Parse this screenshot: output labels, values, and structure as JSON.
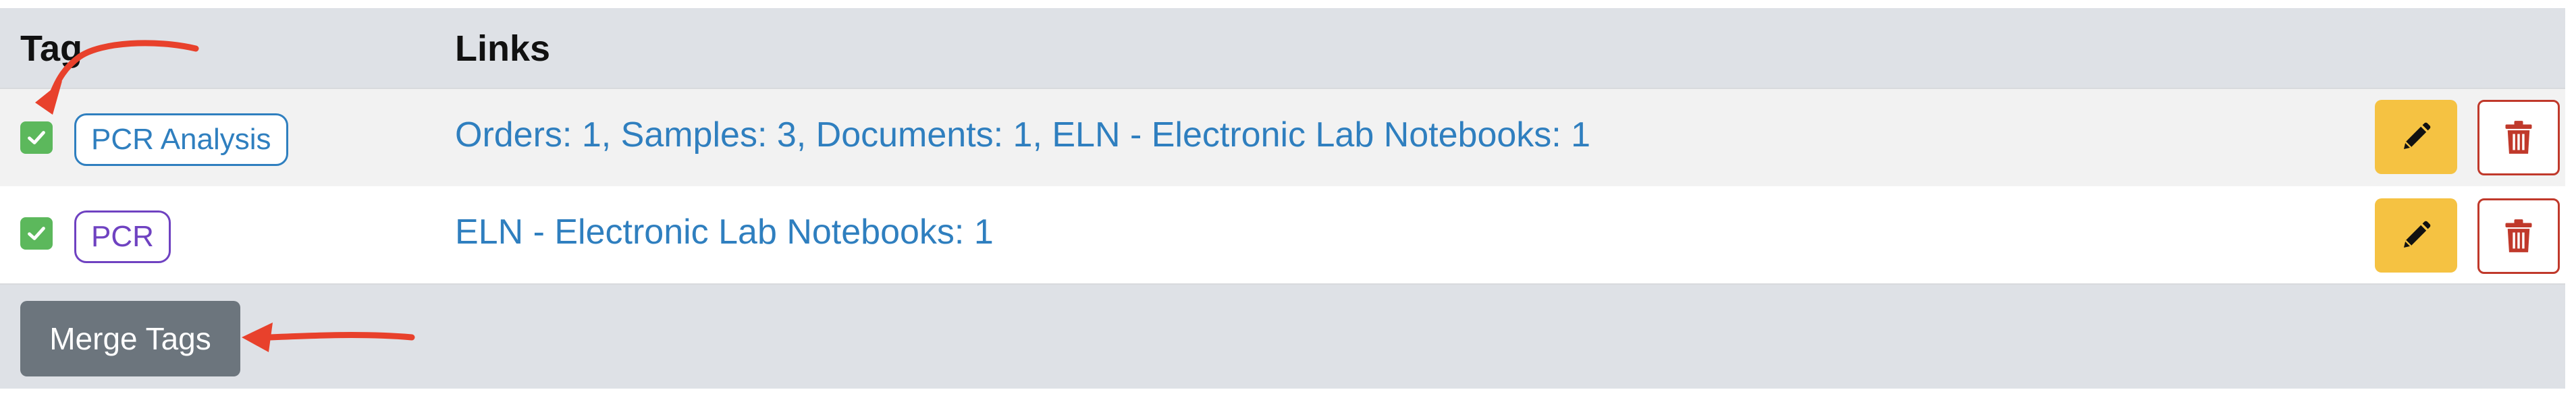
{
  "table": {
    "headers": {
      "tag": "Tag",
      "links": "Links"
    },
    "rows": [
      {
        "checked": true,
        "tag": "PCR Analysis",
        "tag_color": "#2f7fbf",
        "links": "Orders: 1, Samples: 3, Documents: 1, ELN - Electronic Lab Notebooks: 1"
      },
      {
        "checked": true,
        "tag": "PCR",
        "tag_color": "#6f42c1",
        "links": "ELN - Electronic Lab Notebooks: 1"
      }
    ],
    "row_actions": {
      "edit_icon": "pencil-icon",
      "delete_icon": "trash-icon"
    }
  },
  "footer": {
    "merge_button_label": "Merge Tags"
  },
  "colors": {
    "header_bg": "#dee1e6",
    "checkbox_green": "#5cb85c",
    "edit_button": "#f5c242",
    "delete_border": "#c0392b",
    "merge_button": "#6c757d",
    "link_blue": "#2f7fbf",
    "annotation_arrow": "#e8412c"
  }
}
